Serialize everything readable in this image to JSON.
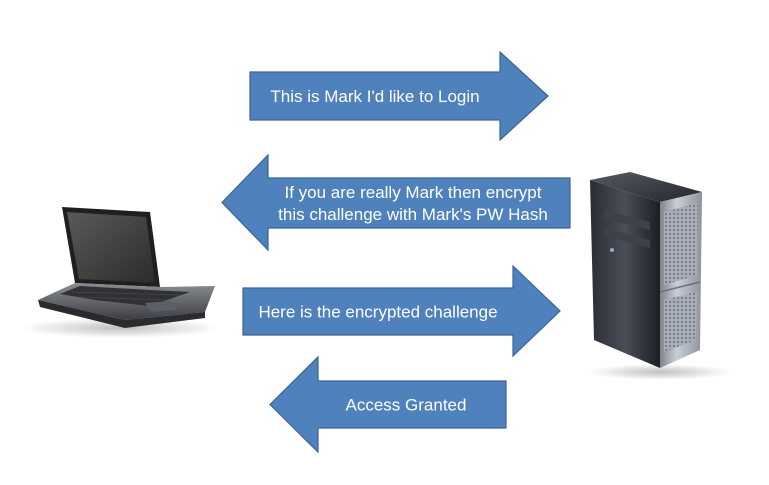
{
  "diagram": {
    "arrows": [
      {
        "direction": "right",
        "lines": [
          "This is Mark I'd like to Login"
        ]
      },
      {
        "direction": "left",
        "lines": [
          "If you are really Mark then encrypt",
          "this challenge with Mark's PW Hash"
        ]
      },
      {
        "direction": "right",
        "lines": [
          "Here is the encrypted challenge"
        ]
      },
      {
        "direction": "left",
        "lines": [
          "Access Granted"
        ]
      }
    ],
    "client_icon": "laptop-icon",
    "server_icon": "server-tower-icon",
    "colors": {
      "arrow_fill": "#4f81bd",
      "arrow_stroke": "#3a6596",
      "arrow_text": "#ffffff"
    }
  }
}
